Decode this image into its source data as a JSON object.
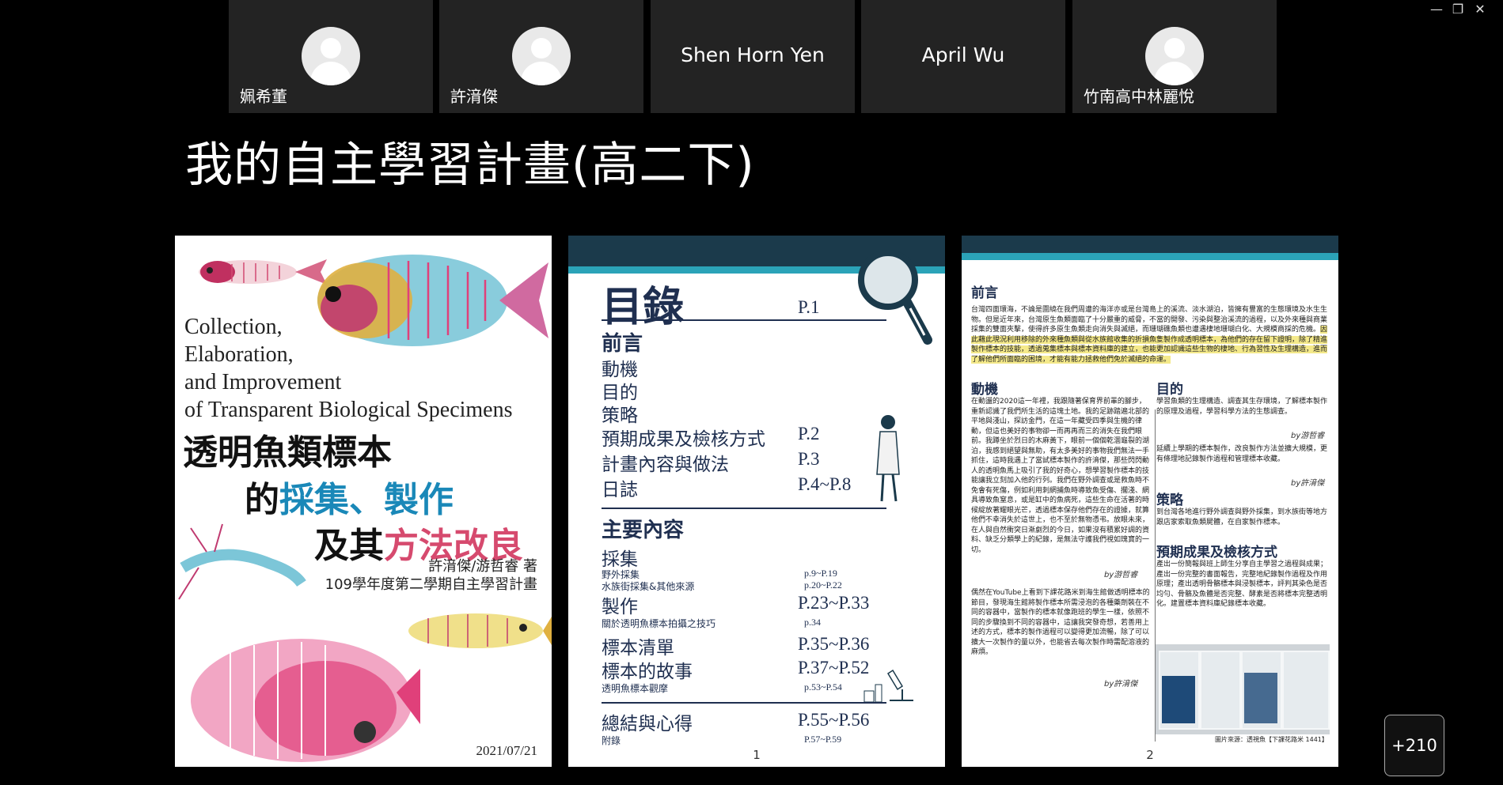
{
  "window": {
    "minimize": "—",
    "restore": "❐",
    "close": "✕"
  },
  "participants": [
    {
      "name": "姵希董",
      "has_avatar": true
    },
    {
      "name": "許湇傑",
      "has_avatar": true
    },
    {
      "name": "Shen Horn Yen",
      "has_avatar": false
    },
    {
      "name": "April Wu",
      "has_avatar": false
    },
    {
      "name": "竹南高中林麗悅",
      "has_avatar": true
    }
  ],
  "slide": {
    "title": "我的自主學習計畫(高二下)"
  },
  "cover": {
    "en_lines": [
      "Collection,",
      "Elaboration,",
      "and Improvement",
      "of Transparent Biological Specimens"
    ],
    "title1": "透明魚類標本",
    "title2_a": "的",
    "title2_b": "採集、製作",
    "title3_a": "及其",
    "title3_b": "方法改良",
    "authors": "許湇傑/游哲睿 著",
    "program": "109學年度第二學期自主學習計畫",
    "date": "2021/07/21"
  },
  "toc": {
    "heading": "目錄",
    "heading_page": "P.1",
    "s1_title": "前言",
    "s1_items": [
      "動機",
      "目的",
      "策略"
    ],
    "s1_rows": [
      {
        "label": "預期成果及檢核方式",
        "page": "P.2"
      },
      {
        "label": "計畫內容與做法",
        "page": "P.3"
      },
      {
        "label": "日誌",
        "page": "P.4~P.8"
      }
    ],
    "s2_title": "主要內容",
    "s2_a": "採集",
    "s2_a_sub": [
      "野外採集",
      "水族街採集&其他來源"
    ],
    "s2_a_sub_pages": [
      "p.9~P.19",
      "p.20~P.22"
    ],
    "s2_b": "製作",
    "s2_b_page": "P.23~P.33",
    "s2_b_sub": "關於透明魚標本拍攝之技巧",
    "s2_b_sub_page": "p.34",
    "s2_c": "標本清單",
    "s2_c_page": "P.35~P.36",
    "s2_d": "標本的故事",
    "s2_d_page": "P.37~P.52",
    "s2_d_sub": "透明魚標本觀摩",
    "s2_d_sub_page": "p.53~P.54",
    "s3": "總結與心得",
    "s3_page": "P.55~P.56",
    "s3_sub": "附錄",
    "s3_sub_page": "P.57~P.59",
    "page_number": "1"
  },
  "intro": {
    "heading": "前言",
    "p1": "台灣四面環海，不論是圍繞在我們周遭的海洋亦或是台灣島上的溪流、淡水湖泊，皆擁有豐富的生態環境及水生生物。但是近年來，台灣原生魚類面臨了十分嚴重的威脅，不當的開發、污染與整治溪流的過程，以及外來種與商業採集的雙面夾擊，使得許多原生魚類走向消失與滅絕，而珊瑚礁魚類也遭遇棲地珊瑚白化、大規模商採的危機。",
    "p1_hl": "因此藉此現況利用移除的外來種魚類與從水族館收集的折損魚隻製作成透明標本，為他們的存在留下證明，除了精進製作標本的技能，透過蒐集標本與標本資料庫的建立，也能更加認識這些生物的棲地、行為習性及生理構造，進而了解他們所面臨的困境，才能有能力拯救他們免於滅絕的命運。",
    "motive_h": "動機",
    "motive": "在動盪的2020這一年裡，我跟隨著保育界前輩的腳步，重新認識了我們所生活的這塊土地。我的足跡踏遍北部的平地與淺山，探訪金門，在這一年藏受四季與生機的律動，但這也美好的事物卻一而再再而三的消失在我們眼前。我蹲坐於烈日的木麻黃下，眼前一個個乾涸龜裂的湖泊，我感到絕望與無助，有太多美好的事物我們無法一手抓住，這時我遇上了當試標本製作的許湇傑，那些閃閃動人的透明魚馬上吸引了我的好奇心，想學習製作標本的技能讓我立刻加入他的行列。我們在野外調查或是救魚時不免會有死傷，例如利用刺網捕魚時導致魚受傷、擱淺、網具導致魚窒息，或是缸中的魚病死，這些生命在活著的時候綻放著耀眼光芒，透過標本保存他們存在的證據，就算他們不幸消失於這世上，也不至於無物憑弔。放眼未來，在人與自然衝突日漸劇烈的今日，如果沒有積累好調的資料、缺乏分類學上的紀錄，是無法守護我們視如瑰寶的一切。",
    "motive_by": "by游哲睿",
    "motive2": "偶然在YouTube上看到下課花路米到海生館做透明標本的節目，發現海生館將製作標本所需浸泡的各種藥劑裝在不同的容器中，當製作的標本就像跑班的學生一樣，依照不同的步驟換到不同的容器中，這讓我突發奇想，若善用上述的方式，標本的製作過程可以變得更加流暢，除了可以擴大一次製作的量以外，也能省去每次製作時需配溶液的麻煩。",
    "motive2_by": "by許湇傑",
    "purpose_h": "目的",
    "purpose": "學習魚類的生理構造、調查其生存環境，了解標本製作的原理及過程，學習科學方法的生態調查。",
    "purpose_by": "by游哲睿",
    "purpose2": "延續上學期的標本製作，改良製作方法並擴大規模，更有條理地記錄製作過程和管理標本收藏。",
    "purpose2_by": "by許湇傑",
    "strategy_h": "策略",
    "strategy": "到台灣各地進行野外調查與野外採集，到水族街等地方跟店家索取魚類屍體，在自家製作標本。",
    "expect_h": "預期成果及檢核方式",
    "expect": "產出一份簡報與班上師生分享自主學習之過程與成果；產出一份完整的書面報告，完整地紀錄製作過程及作用原理；產出透明骨骼標本與浸製標本，評判其染色是否均勻、骨骼及魚體是否完整、酵素是否將標本完整透明化。建置標本資料庫紀錄標本收藏。",
    "photo_caption": "圖片來源：透視魚【下課花路米 1441】",
    "page_number": "2"
  },
  "overflow": {
    "label": "+210"
  }
}
